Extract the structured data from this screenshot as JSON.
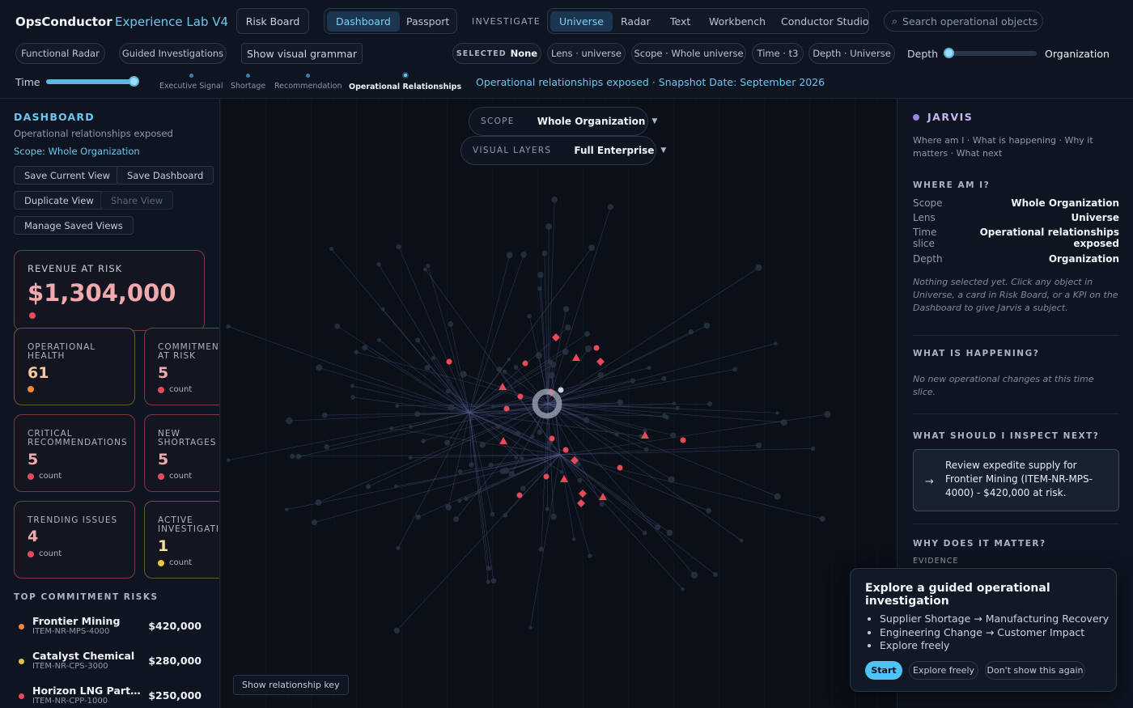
{
  "app": {
    "name": "OpsConductor",
    "product": "Experience Lab V4"
  },
  "nav": {
    "risk_board": "Risk Board",
    "view_tabs": [
      "Dashboard",
      "Passport"
    ],
    "investigate_label": "INVESTIGATE",
    "investigate_tabs": [
      "Universe",
      "Radar",
      "Text",
      "Workbench",
      "Conductor Studio"
    ],
    "search_placeholder": "Search operational objects"
  },
  "toolbar": {
    "functional_radar": "Functional Radar",
    "guided_investigations": "Guided Investigations",
    "visual_grammar": "Show visual grammar",
    "selected_label": "SELECTED",
    "selected_value": "None",
    "lens": "Lens · universe",
    "scope": "Scope · Whole universe",
    "time": "Time · t3",
    "depth_pill": "Depth · Universe",
    "depth_label": "Depth",
    "depth_value": "Organization",
    "depth_level": 0
  },
  "timeline": {
    "label": "Time",
    "level": 1,
    "stops": [
      "Executive Signal",
      "Shortage",
      "Recommendation",
      "Operational Relationships"
    ],
    "active": 3,
    "caption": "Operational relationships exposed · Snapshot Date: September 2026"
  },
  "dashboard": {
    "title": "DASHBOARD",
    "subtitle": "Operational relationships exposed",
    "scope": "Scope: Whole Organization",
    "buttons": [
      "Save Current View",
      "Save Dashboard",
      "Duplicate View",
      "Share View",
      "Manage Saved Views"
    ],
    "revenue": {
      "label": "REVENUE AT RISK",
      "value": "$1,304,000"
    },
    "kpis": [
      {
        "label": "OPERATIONAL\nHEALTH",
        "value": "61",
        "caption": "",
        "color": "#f08a3a"
      },
      {
        "label": "COMMITMENTS\nAT RISK",
        "value": "5",
        "caption": "count",
        "color": "#e84a5a"
      },
      {
        "label": "CRITICAL\nRECOMMENDATIONS",
        "value": "5",
        "caption": "count",
        "color": "#e84a5a"
      },
      {
        "label": "NEW\nSHORTAGES",
        "value": "5",
        "caption": "count",
        "color": "#e84a5a"
      },
      {
        "label": "TRENDING ISSUES",
        "value": "4",
        "caption": "count",
        "color": "#e84a5a"
      },
      {
        "label": "ACTIVE\nINVESTIGATIONS",
        "value": "1",
        "caption": "count",
        "color": "#e8c23a"
      }
    ],
    "risks_title": "TOP COMMITMENT RISKS",
    "risks": [
      {
        "name": "Frontier Mining",
        "id": "ITEM-NR-MPS-4000",
        "value": "$420,000",
        "color": "#f08a3a"
      },
      {
        "name": "Catalyst Chemical",
        "id": "ITEM-NR-CPS-3000",
        "value": "$280,000",
        "color": "#e8c23a"
      },
      {
        "name": "Horizon LNG Partners",
        "id": "ITEM-NR-CPP-1000",
        "value": "$250,000",
        "color": "#e84a5a"
      }
    ]
  },
  "canvas": {
    "scope_label": "SCOPE",
    "scope_value": "Whole Organization",
    "layers_label": "VISUAL LAYERS",
    "layers_value": "Full Enterprise",
    "key_button": "Show relationship key"
  },
  "jarvis": {
    "title": "JARVIS",
    "subtitle": "Where am I · What is happening · Why it matters · What next",
    "where_title": "WHERE AM I?",
    "rows": [
      {
        "k": "Scope",
        "v": "Whole Organization"
      },
      {
        "k": "Lens",
        "v": "Universe"
      },
      {
        "k": "Time\nslice",
        "v": "Operational relationships\nexposed"
      },
      {
        "k": "Depth",
        "v": "Organization"
      }
    ],
    "nothing_selected": "Nothing selected yet. Click any object in Universe, a card in Risk Board, or a KPI on the Dashboard to give Jarvis a subject.",
    "happening_title": "WHAT IS HAPPENING?",
    "happening_text": "No new operational changes at this time slice.",
    "inspect_title": "WHAT SHOULD I INSPECT NEXT?",
    "inspect_text": "Review expedite supply for Frontier Mining (ITEM-NR-MPS-4000) - $420,000 at risk.",
    "why_title": "WHY DOES IT MATTER?",
    "evidence_label": "EVIDENCE"
  },
  "guide": {
    "title": "Explore a guided operational investigation",
    "items": [
      "Supplier Shortage → Manufacturing Recovery",
      "Engineering Change → Customer Impact",
      "Explore freely"
    ],
    "start": "Start",
    "explore": "Explore freely",
    "dismiss": "Don't show this again"
  },
  "colors": {
    "accent": "#6cc8f0",
    "risk": "#e84a5a",
    "bg": "#0b1019",
    "jarvis": "#9b86e6"
  }
}
